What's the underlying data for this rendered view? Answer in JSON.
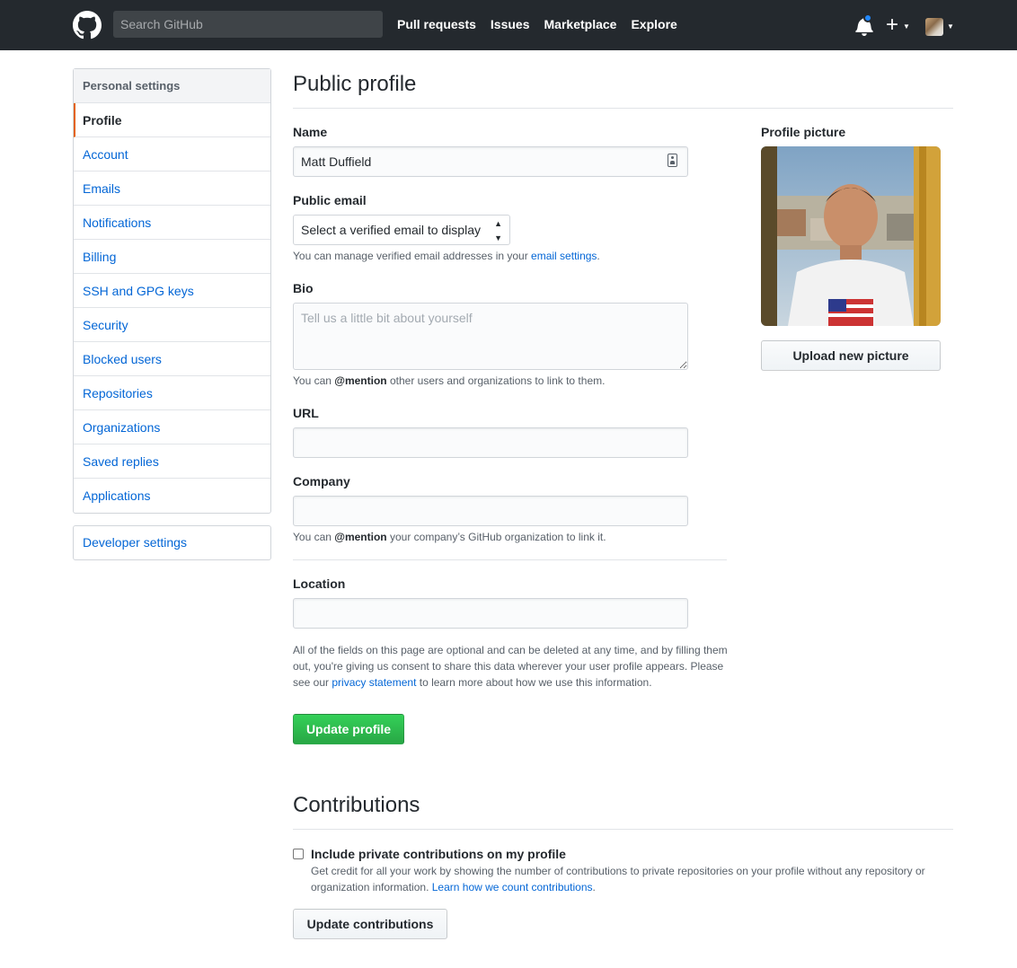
{
  "header": {
    "search_placeholder": "Search GitHub",
    "nav": [
      "Pull requests",
      "Issues",
      "Marketplace",
      "Explore"
    ],
    "icons": [
      "github-logo-icon",
      "bell-icon",
      "plus-icon",
      "avatar"
    ]
  },
  "sidebar": {
    "heading": "Personal settings",
    "items": [
      {
        "label": "Profile",
        "selected": true
      },
      {
        "label": "Account"
      },
      {
        "label": "Emails"
      },
      {
        "label": "Notifications"
      },
      {
        "label": "Billing"
      },
      {
        "label": "SSH and GPG keys"
      },
      {
        "label": "Security"
      },
      {
        "label": "Blocked users"
      },
      {
        "label": "Repositories"
      },
      {
        "label": "Organizations"
      },
      {
        "label": "Saved replies"
      },
      {
        "label": "Applications"
      }
    ],
    "developer_settings": "Developer settings"
  },
  "profile": {
    "title": "Public profile",
    "name_label": "Name",
    "name_value": "Matt Duffield",
    "email_label": "Public email",
    "email_select": "Select a verified email to display",
    "email_note_prefix": "You can manage verified email addresses in your ",
    "email_note_link": "email settings",
    "email_note_suffix": ".",
    "bio_label": "Bio",
    "bio_placeholder": "Tell us a little bit about yourself",
    "bio_note_prefix": "You can ",
    "bio_note_mention": "@mention",
    "bio_note_suffix": " other users and organizations to link to them.",
    "url_label": "URL",
    "company_label": "Company",
    "company_note_prefix": "You can ",
    "company_note_mention": "@mention",
    "company_note_suffix": " your company’s GitHub organization to link it.",
    "location_label": "Location",
    "fineprint_prefix": "All of the fields on this page are optional and can be deleted at any time, and by filling them out, you're giving us consent to share this data wherever your user profile appears. Please see our ",
    "fineprint_link": "privacy statement",
    "fineprint_suffix": " to learn more about how we use this information.",
    "update_button": "Update profile",
    "picture_label": "Profile picture",
    "upload_button": "Upload new picture"
  },
  "contributions": {
    "title": "Contributions",
    "checkbox_label": "Include private contributions on my profile",
    "checked": false,
    "desc_prefix": "Get credit for all your work by showing the number of contributions to private repositories on your profile without any repository or organization information. ",
    "desc_link": "Learn how we count contributions",
    "desc_suffix": ".",
    "update_button": "Update contributions"
  },
  "colors": {
    "header_bg": "#24292e",
    "link": "#0366d6",
    "green_button": "#28a745",
    "selected_accent": "#e36209",
    "notification_dot": "#2188ff"
  }
}
